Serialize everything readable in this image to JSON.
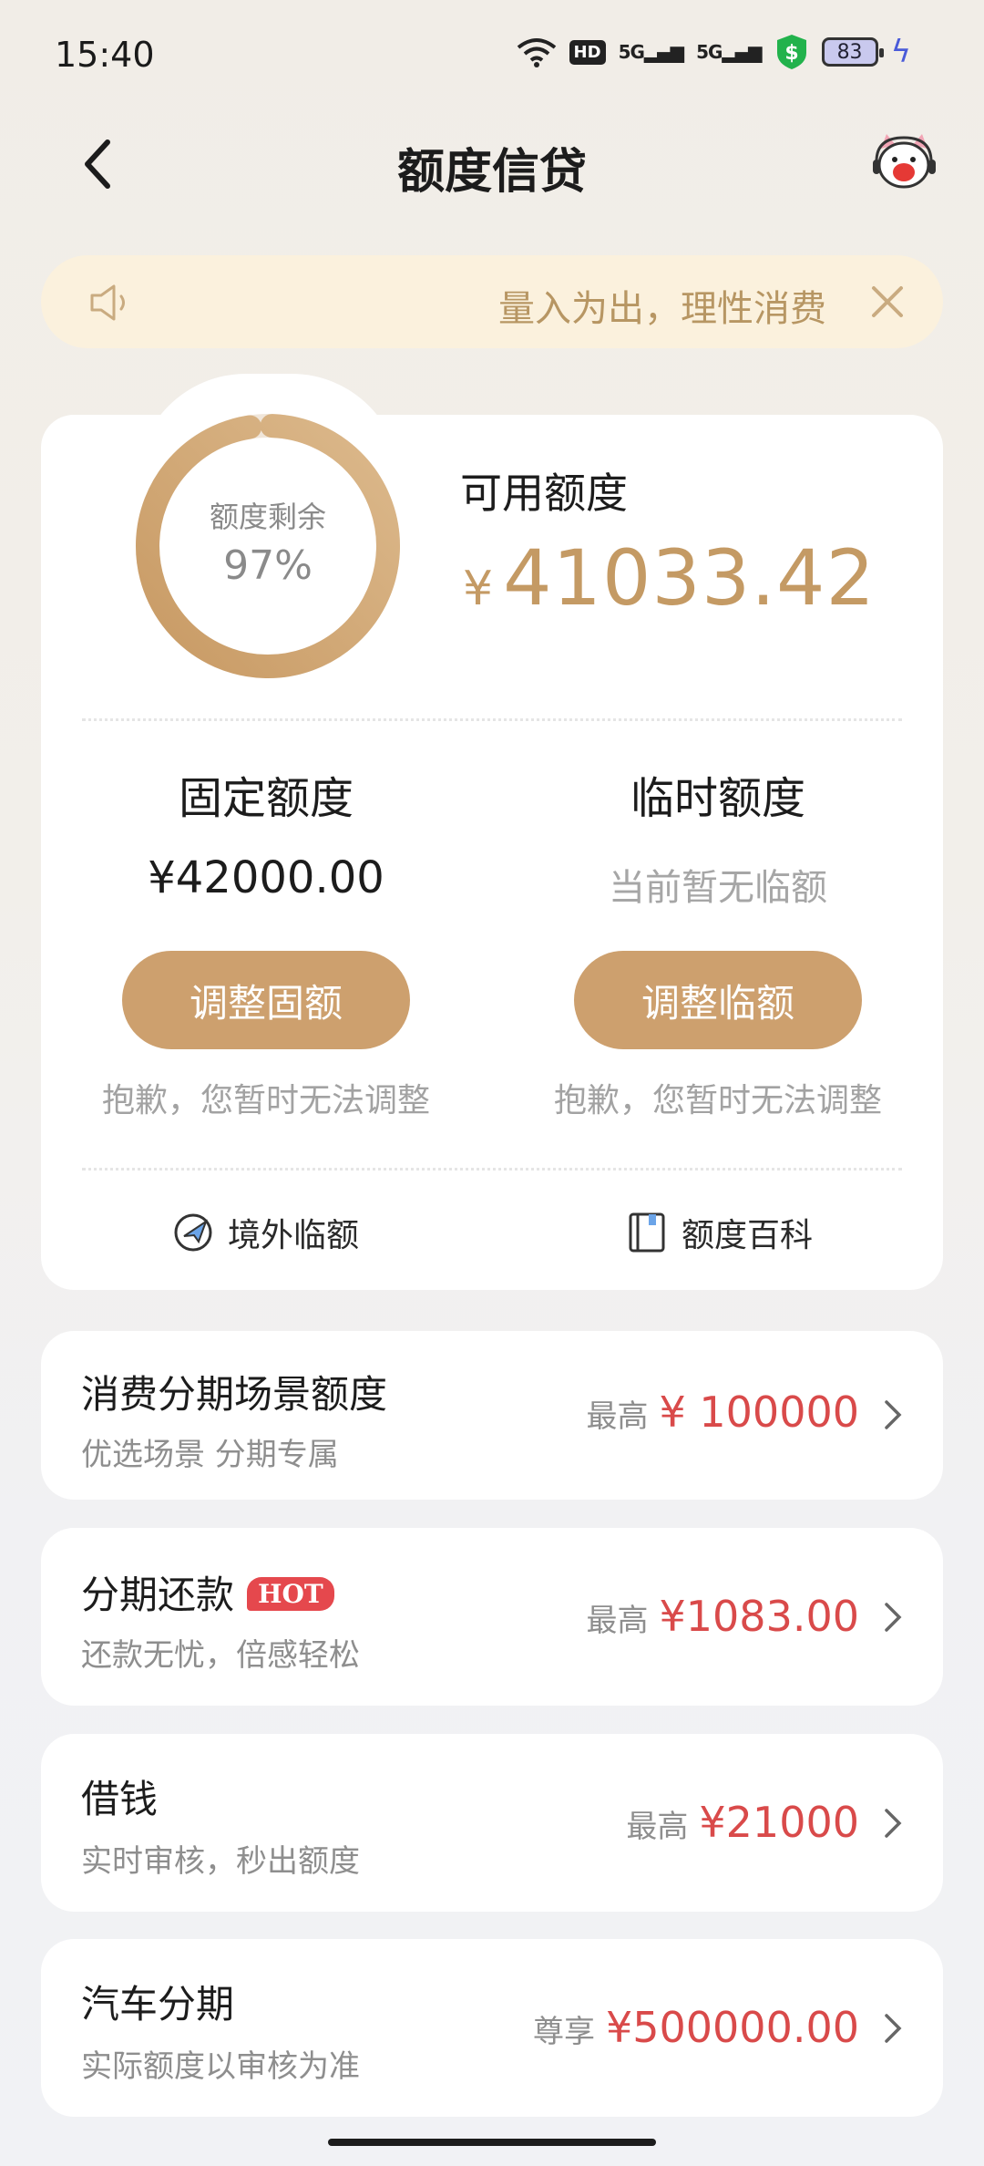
{
  "status": {
    "time": "15:40",
    "battery": "83",
    "signal1": "5G",
    "signal2": "5G",
    "hd": "HD"
  },
  "header": {
    "title": "额度信贷"
  },
  "notice": {
    "text": "量入为出，理性消费"
  },
  "summary": {
    "remaining_label": "额度剩余",
    "remaining_pct": "97%",
    "remaining_fraction": 0.97,
    "available_label": "可用额度",
    "currency": "¥",
    "available_amount": "41033.42"
  },
  "fixed": {
    "title": "固定额度",
    "value": "¥42000.00",
    "button": "调整固额",
    "note": "抱歉，您暂时无法调整"
  },
  "temporary": {
    "title": "临时额度",
    "value": "当前暂无临额",
    "button": "调整临额",
    "note": "抱歉，您暂时无法调整"
  },
  "links": {
    "overseas": "境外临额",
    "wiki": "额度百科"
  },
  "items": [
    {
      "title": "消费分期场景额度",
      "subtitle": "优选场景 分期专属",
      "prefix": "最高",
      "amount": "¥ 100000"
    },
    {
      "title": "分期还款",
      "badge": "HOT",
      "subtitle": "还款无忧，倍感轻松",
      "prefix": "最高",
      "amount": "¥1083.00"
    },
    {
      "title": "借钱",
      "subtitle": "实时审核，秒出额度",
      "prefix": "最高",
      "amount": "¥21000"
    },
    {
      "title": "汽车分期",
      "subtitle": "实际额度以审核为准",
      "prefix": "尊享",
      "amount": "¥500000.00"
    }
  ],
  "colors": {
    "accent": "#cda06e",
    "amount": "#d94a4a",
    "notice_bg": "#fbf1dd"
  }
}
